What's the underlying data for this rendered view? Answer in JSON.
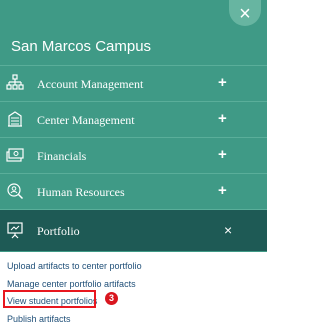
{
  "campus_name": "San Marcos Campus",
  "close_icon": "×",
  "menu": [
    {
      "label": "Account Management",
      "icon": "org-chart-icon",
      "toggle": "+"
    },
    {
      "label": "Center Management",
      "icon": "building-icon",
      "toggle": "+"
    },
    {
      "label": "Financials",
      "icon": "money-icon",
      "toggle": "+"
    },
    {
      "label": "Human Resources",
      "icon": "person-search-icon",
      "toggle": "+"
    },
    {
      "label": "Portfolio",
      "icon": "presentation-icon",
      "toggle": "×",
      "expanded": true
    }
  ],
  "portfolio_links": [
    "Upload artifacts to center portfolio",
    "Manage center portfolio artifacts",
    "View student portfolios",
    "Publish artifacts"
  ],
  "step_badge": "3",
  "colors": {
    "menu_bg": "#3f9a86",
    "active_bg": "#1e5a55",
    "link": "#1f4f78",
    "highlight": "#e8171f"
  }
}
